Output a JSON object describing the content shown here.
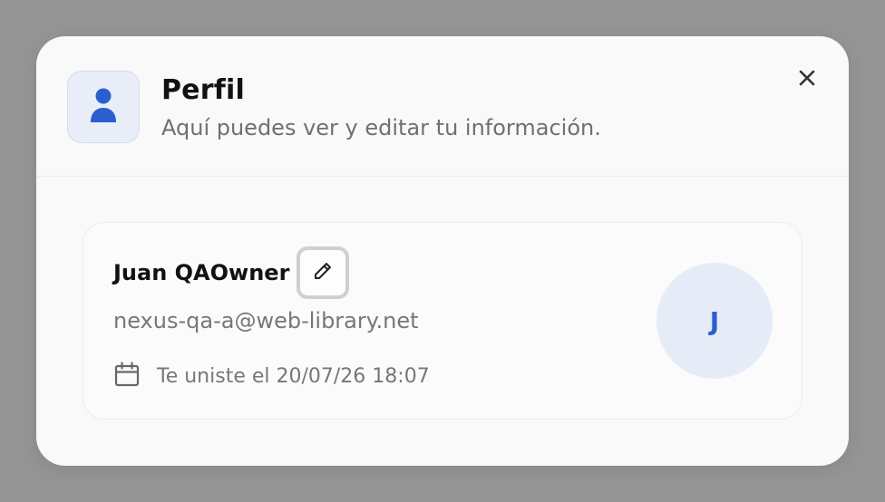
{
  "modal": {
    "title": "Perfil",
    "subtitle": "Aquí puedes ver y editar tu información.",
    "header_icon": "user-icon",
    "close_icon": "close-icon"
  },
  "profile": {
    "name": "Juan QAOwner",
    "edit_icon": "pencil-icon",
    "email": "nexus-qa-a@web-library.net",
    "join_icon": "calendar-icon",
    "joined_text": "Te uniste el 20/07/26 18:07",
    "avatar_initial": "J"
  },
  "colors": {
    "accent": "#2b5fcf",
    "backdrop": "#949494",
    "modal_bg": "#f9f9f9",
    "icon_box_bg": "#e8edf8",
    "avatar_bg": "#e6ecf7"
  }
}
